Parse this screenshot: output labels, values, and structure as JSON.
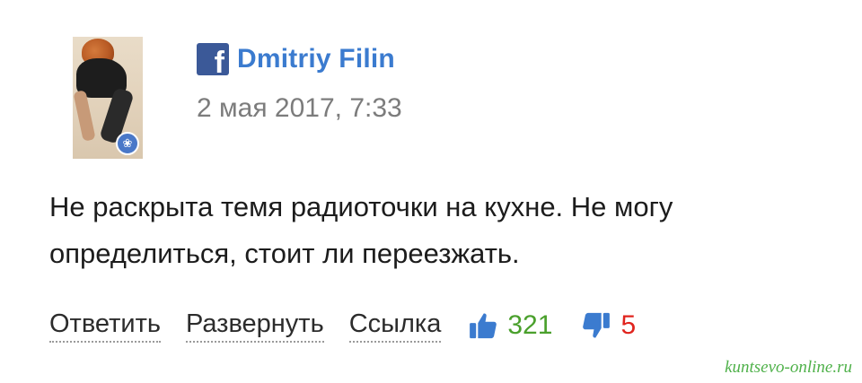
{
  "author": {
    "name": "Dmitriy Filin",
    "network_icon": "facebook-icon",
    "avatar_badge_icon": "ribbon-icon"
  },
  "comment": {
    "date": "2 мая 2017, 7:33",
    "text": "Не раскрыта темя радиоточки на кухне. Не могу определиться, стоит ли переезжать."
  },
  "actions": {
    "reply_label": "Ответить",
    "expand_label": "Развернуть",
    "link_label": "Ссылка",
    "likes": "321",
    "dislikes": "5",
    "like_icon": "thumbs-up-icon",
    "dislike_icon": "thumbs-down-icon"
  },
  "colors": {
    "author_link": "#3b7bcf",
    "facebook_blue": "#3b5998",
    "likes_green": "#4aa02c",
    "dislikes_red": "#e0241e",
    "watermark_green": "#4fb14a"
  },
  "watermark": "kuntsevo-online.ru"
}
